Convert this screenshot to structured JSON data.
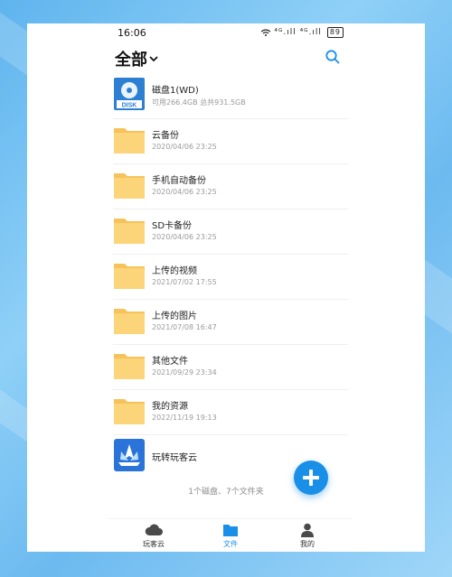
{
  "status_bar": {
    "time": "16:06",
    "signal_text": "⁴ᴳ.ıll ⁴ᴳ.ıll",
    "battery": "89"
  },
  "header": {
    "title": "全部",
    "dropdown_icon": "chevron-down-icon",
    "search_icon": "search-icon"
  },
  "list": {
    "items": [
      {
        "name": "磁盘1(WD)",
        "sub": "可用266.4GB 总共931.5GB",
        "icon": "disk-icon",
        "icon_label": "DISK"
      },
      {
        "name": "云备份",
        "sub": "2020/04/06 23:25",
        "icon": "folder-icon"
      },
      {
        "name": "手机自动备份",
        "sub": "2020/04/06 23:25",
        "icon": "folder-icon"
      },
      {
        "name": "SD卡备份",
        "sub": "2020/04/06 23:25",
        "icon": "folder-icon"
      },
      {
        "name": "上传的视频",
        "sub": "2021/07/02 17:55",
        "icon": "folder-icon"
      },
      {
        "name": "上传的图片",
        "sub": "2021/07/08 16:47",
        "icon": "folder-icon"
      },
      {
        "name": "其他文件",
        "sub": "2021/09/29 23:34",
        "icon": "folder-icon"
      },
      {
        "name": "我的资源",
        "sub": "2022/11/19 19:13",
        "icon": "folder-icon"
      },
      {
        "name": "玩转玩客云",
        "sub": "",
        "icon": "app-logo-icon"
      }
    ]
  },
  "summary": "1个磁盘、7个文件夹",
  "fab": {
    "icon": "plus-icon"
  },
  "tabbar": {
    "tabs": [
      {
        "label": "玩客云",
        "icon": "cloud-icon",
        "active": false
      },
      {
        "label": "文件",
        "icon": "folder-icon",
        "active": true
      },
      {
        "label": "我的",
        "icon": "person-icon",
        "active": false
      }
    ]
  },
  "colors": {
    "accent": "#1a8fe8",
    "folder": "#fcd57a",
    "disk": "#2d7fd3"
  }
}
